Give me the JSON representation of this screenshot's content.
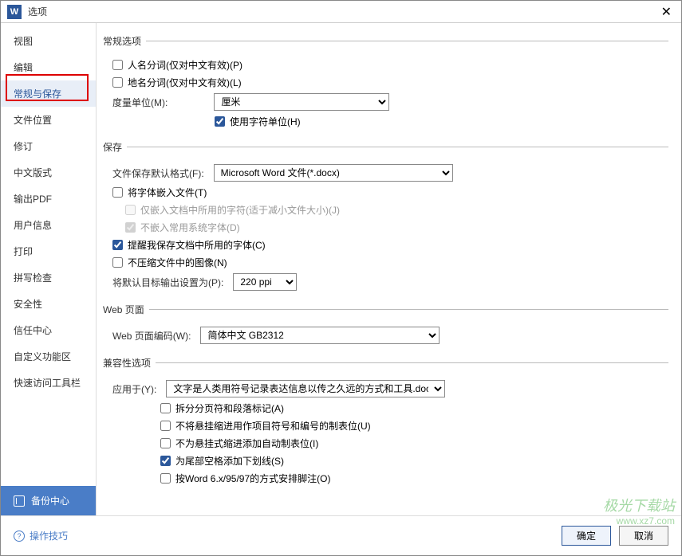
{
  "titlebar": {
    "app_letter": "W",
    "title": "选项"
  },
  "sidebar": {
    "items": [
      {
        "label": "视图"
      },
      {
        "label": "编辑"
      },
      {
        "label": "常规与保存"
      },
      {
        "label": "文件位置"
      },
      {
        "label": "修订"
      },
      {
        "label": "中文版式"
      },
      {
        "label": "输出PDF"
      },
      {
        "label": "用户信息"
      },
      {
        "label": "打印"
      },
      {
        "label": "拼写检查"
      },
      {
        "label": "安全性"
      },
      {
        "label": "信任中心"
      },
      {
        "label": "自定义功能区"
      },
      {
        "label": "快速访问工具栏"
      }
    ],
    "highlighted_index": 1,
    "active_index": 2,
    "backup_label": "备份中心"
  },
  "sections": {
    "general": {
      "legend": "常规选项",
      "person_name": "人名分词(仅对中文有效)(P)",
      "place_name": "地名分词(仅对中文有效)(L)",
      "unit_label": "度量单位(M):",
      "unit_value": "厘米",
      "use_char_unit": "使用字符单位(H)"
    },
    "save": {
      "legend": "保存",
      "default_format_label": "文件保存默认格式(F):",
      "default_format_value": "Microsoft Word 文件(*.docx)",
      "embed_fonts": "将字体嵌入文件(T)",
      "embed_only_used": "仅嵌入文档中所用的字符(适于减小文件大小)(J)",
      "no_embed_system": "不嵌入常用系统字体(D)",
      "remind_fonts": "提醒我保存文档中所用的字体(C)",
      "no_compress_images": "不压缩文件中的图像(N)",
      "default_res_label": "将默认目标输出设置为(P):",
      "default_res_value": "220 ppi"
    },
    "web": {
      "legend": "Web 页面",
      "encoding_label": "Web 页面编码(W):",
      "encoding_value": "简体中文 GB2312"
    },
    "compat": {
      "legend": "兼容性选项",
      "apply_to_label": "应用于(Y):",
      "apply_to_value": "文字是人类用符号记录表达信息以传之久远的方式和工具.docx",
      "split_page": "拆分分页符和段落标记(A)",
      "no_hanging": "不将悬挂缩进用作项目符号和编号的制表位(U)",
      "no_auto_tab": "不为悬挂式缩进添加自动制表位(I)",
      "trailing_underline": "为尾部空格添加下划线(S)",
      "word6_footnote": "按Word 6.x/95/97的方式安排脚注(O)"
    }
  },
  "footer": {
    "tips": "操作技巧",
    "ok": "确定",
    "cancel": "取消"
  },
  "watermark": {
    "line1": "极光下载站",
    "line2": "www.xz7.com"
  }
}
